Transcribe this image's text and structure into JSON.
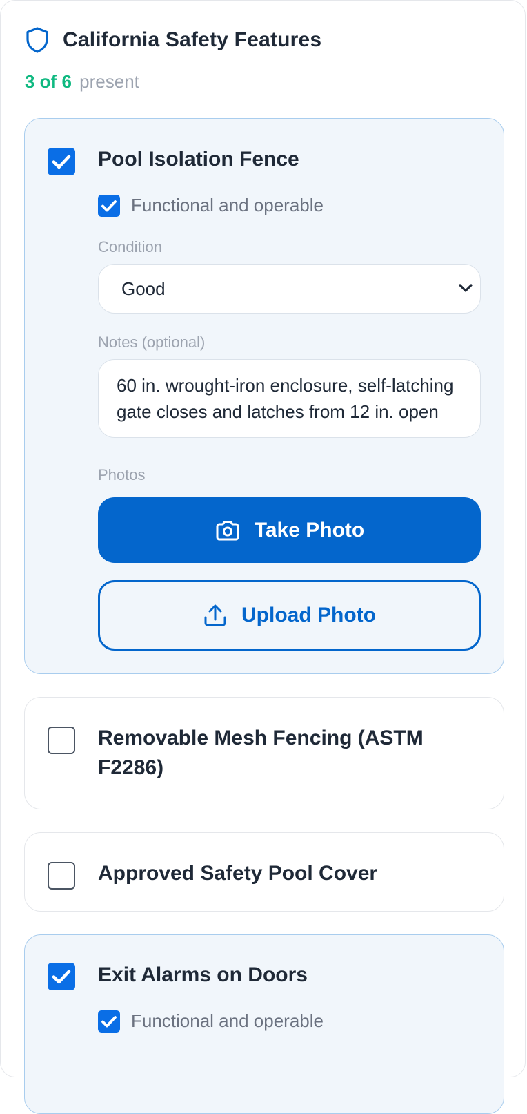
{
  "section": {
    "title": "California Safety Features",
    "summary_count": "3 of 6",
    "summary_suffix": "present",
    "icon": "shield-icon"
  },
  "features": [
    {
      "title": "Pool Isolation Fence",
      "present": true,
      "functional": true,
      "functional_label": "Functional and operable",
      "condition_label": "Condition",
      "condition_value": "Good",
      "notes_label": "Notes (optional)",
      "notes_value": "60 in. wrought-iron enclosure, self-latching gate closes and latches from 12 in. open",
      "photos_label": "Photos",
      "take_photo_label": "Take Photo",
      "upload_photo_label": "Upload Photo"
    },
    {
      "title": "Removable Mesh Fencing (ASTM F2286)",
      "present": false
    },
    {
      "title": "Approved Safety Pool Cover",
      "present": false
    },
    {
      "title": "Exit Alarms on Doors",
      "present": true,
      "functional": true,
      "functional_label": "Functional and operable"
    }
  ],
  "colors": {
    "accent": "#0466CC",
    "checkbox": "#0A6EE6",
    "success": "#10B981",
    "active_card_bg": "#F1F6FB",
    "active_card_border": "#A9CDEE"
  }
}
